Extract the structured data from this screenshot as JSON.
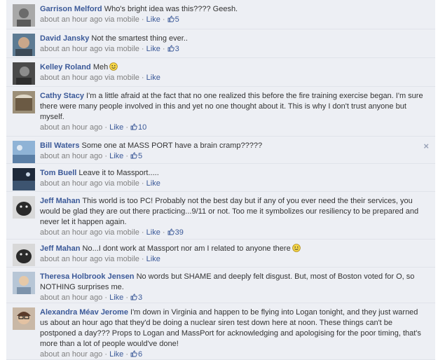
{
  "comments": [
    {
      "name": "Garrison Melford",
      "text": "Who's bright idea was this???? Geesh.",
      "meta": "about an hour ago via mobile · ",
      "like": "Like",
      "count": "5",
      "avatar": "gray-silhouette"
    },
    {
      "name": "David Jansky",
      "text": "Not the smartest thing ever..",
      "meta": "about an hour ago via mobile · ",
      "like": "Like",
      "count": "3",
      "avatar": "blue-photo"
    },
    {
      "name": "Kelley Roland",
      "text": "Meh",
      "meta": "about an hour ago via mobile · ",
      "like": "Like",
      "count": "",
      "avatar": "dark-photo"
    },
    {
      "name": "Cathy Stacy",
      "text": "I'm a little afraid at the fact that no one realized this before the fire training exercise began. I'm sure there were many people involved in this and yet no one thought about it. This is why I don't trust anyone but myself.",
      "meta": "about an hour ago · ",
      "like": "Like",
      "count": "10",
      "avatar": "drum-photo"
    },
    {
      "name": "Bill Waters",
      "text": "Some one at MASS PORT have a brain cramp?????",
      "meta": "about an hour ago · ",
      "like": "Like",
      "count": "5",
      "avatar": "sky-photo"
    },
    {
      "name": "Tom Buell",
      "text": "Leave it to Massport.....",
      "meta": "about an hour ago via mobile · ",
      "like": "Like",
      "count": "",
      "avatar": "night-photo"
    },
    {
      "name": "Jeff Mahan",
      "text": "This world is too PC! Probably not the best day but if any of you ever need the their services, you would be glad they are out there practicing...9/11 or not. Too me it symbolizes our resiliency to be prepared and never let it happen again.",
      "meta": "about an hour ago via mobile · ",
      "like": "Like",
      "count": "39",
      "avatar": "bw-dog"
    },
    {
      "name": "Jeff Mahan",
      "text": "No...I dont work at Massport nor am I related to anyone there",
      "meta": "about an hour ago via mobile · ",
      "like": "Like",
      "count": "",
      "avatar": "bw-dog"
    },
    {
      "name": "Theresa Holbrook Jensen",
      "text": "No words but SHAME and deeply felt disgust. But, most of Boston voted for O, so NOTHING surprises me.",
      "meta": "about an hour ago · ",
      "like": "Like",
      "count": "3",
      "avatar": "light-portrait"
    },
    {
      "name": "Alexandra Méav Jerome",
      "text": "I'm down in Virginia and happen to be flying into Logan tonight, and they just warned us about an hour ago that they'd be doing a nuclear siren test down here at noon. These things can't be postponed a day??? Props to Logan and MassPort for acknowledging and apologising for the poor timing, that's more than a lot of people would've done!",
      "meta": "about an hour ago · ",
      "like": "Like",
      "count": "6",
      "avatar": "glasses-portrait"
    }
  ],
  "close_glyph": "×",
  "colors": {
    "name": "#3b5998",
    "bg": "#edeff4",
    "meta": "#808080"
  }
}
